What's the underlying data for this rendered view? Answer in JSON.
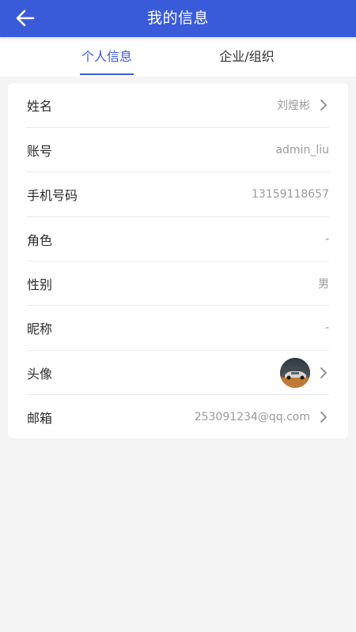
{
  "header": {
    "title": "我的信息",
    "back_icon": "arrow-left-icon"
  },
  "tabs": [
    {
      "label": "个人信息",
      "active": true
    },
    {
      "label": "企业/组织",
      "active": false
    }
  ],
  "profile": {
    "rows": [
      {
        "label": "姓名",
        "value": "刘煌彬",
        "chevron": true
      },
      {
        "label": "账号",
        "value": "admin_liu",
        "chevron": false
      },
      {
        "label": "手机号码",
        "value": "13159118657",
        "chevron": false
      },
      {
        "label": "角色",
        "value": "-",
        "chevron": false
      },
      {
        "label": "性别",
        "value": "男",
        "chevron": false
      },
      {
        "label": "昵称",
        "value": "-",
        "chevron": false
      },
      {
        "label": "头像",
        "value": "",
        "chevron": true
      },
      {
        "label": "邮箱",
        "value": "253091234@qq.com",
        "chevron": true
      }
    ]
  },
  "colors": {
    "primary": "#3a5bd9",
    "background": "#f4f4f4",
    "value_text": "#9a9a9a"
  }
}
